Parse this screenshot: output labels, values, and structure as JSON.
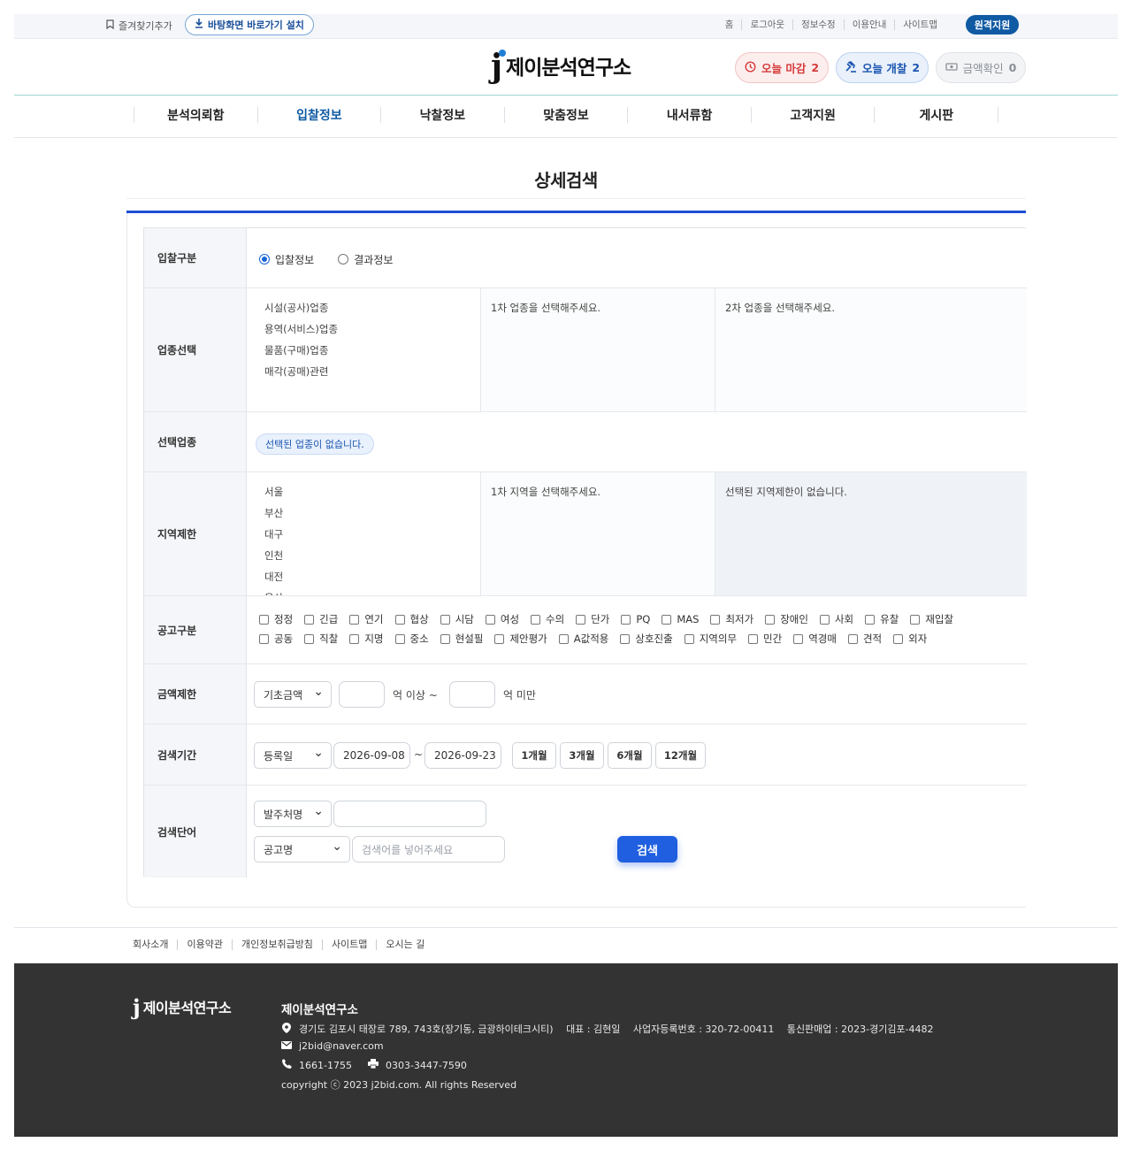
{
  "topbar": {
    "bookmark": "즐겨찾기추가",
    "install": "바탕화면 바로가기 설치",
    "links": [
      "홈",
      "로그아웃",
      "정보수정",
      "이용안내",
      "사이트맵"
    ],
    "remote": "원격지원"
  },
  "header": {
    "logo_j": "j",
    "logo_text": "제이분석연구소",
    "deadline_label": "오늘 마감",
    "deadline_count": "2",
    "open_label": "오늘 개찰",
    "open_count": "2",
    "amount_label": "금액확인",
    "amount_count": "0"
  },
  "nav": [
    "분석의뢰함",
    "입찰정보",
    "낙찰정보",
    "맞춤정보",
    "내서류함",
    "고객지원",
    "게시판"
  ],
  "page_title": "상세검색",
  "form": {
    "bid_type": {
      "label": "입찰구분",
      "options": [
        "입찰정보",
        "결과정보"
      ]
    },
    "industry": {
      "label": "업종선택",
      "list": [
        "시설(공사)업종",
        "용역(서비스)업종",
        "물품(구매)업종",
        "매각(공매)관련"
      ],
      "col2": "1차 업종을 선택해주세요.",
      "col3": "2차 업종을 선택해주세요."
    },
    "selected_industry": {
      "label": "선택업종",
      "chip": "선택된 업종이 없습니다."
    },
    "region": {
      "label": "지역제한",
      "list": [
        "서울",
        "부산",
        "대구",
        "인천",
        "대전",
        "울산"
      ],
      "col2": "1차 지역을 선택해주세요.",
      "col3": "선택된 지역제한이 없습니다."
    },
    "notice_type": {
      "label": "공고구분",
      "row1": [
        "정정",
        "긴급",
        "연기",
        "협상",
        "시담",
        "여성",
        "수의",
        "단가",
        "PQ",
        "MAS",
        "최저가",
        "장애인",
        "사회",
        "유찰",
        "재입찰"
      ],
      "row2": [
        "공동",
        "직찰",
        "지명",
        "중소",
        "현설필",
        "제안평가",
        "A값적용",
        "상호진출",
        "지역의무",
        "민간",
        "역경매",
        "견적",
        "외자"
      ]
    },
    "amount": {
      "label": "금액제한",
      "select": "기초금액",
      "min_value": "",
      "min_suffix": "억 이상 ~",
      "max_value": "",
      "max_suffix": "억 미만"
    },
    "period": {
      "label": "검색기간",
      "select": "등록일",
      "from": "2026-09-08",
      "sep": "~",
      "to": "2026-09-23",
      "buttons": [
        "1개월",
        "3개월",
        "6개월",
        "12개월"
      ]
    },
    "keyword": {
      "label": "검색단어",
      "select1": "발주처명",
      "input1": "",
      "select2": "공고명",
      "placeholder2": "검색어를 넣어주세요",
      "search": "검색"
    }
  },
  "footer": {
    "links": [
      "회사소개",
      "이용약관",
      "개인정보취급방침",
      "사이트맵",
      "오시는 길"
    ],
    "logo_j": "j",
    "logo_text": "제이분석연구소",
    "company": "제이분석연구소",
    "address": "경기도 김포시 태장로 789, 743호(장기동, 금광하이테크시티)　 대표 : 김현일　 사업자등록번호 : 320-72-00411　 통신판매업 : 2023-경기김포-4482",
    "email": "j2bid@naver.com",
    "phone": "1661-1755",
    "fax": "0303-3447-7590",
    "copyright": "copyright ⓒ 2023 j2bid.com. All rights Reserved"
  },
  "colors": {
    "primary": "#1c4fd6",
    "brand": "#0f5aa3",
    "deadline": "#d53a3a",
    "footer_bg": "#333333"
  }
}
